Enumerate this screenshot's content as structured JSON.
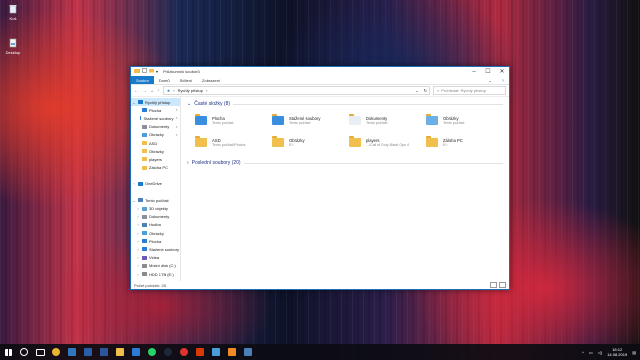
{
  "desktop": {
    "icons": [
      {
        "label": "Koš",
        "icon": "recycle-bin-icon"
      },
      {
        "label": "Desktop",
        "icon": "desktop-file-icon"
      }
    ]
  },
  "window": {
    "title": "Průzkumník souborů",
    "ribbon_tabs": [
      "Soubor",
      "Domů",
      "Sdílení",
      "Zobrazení"
    ],
    "address_path": "Rychlý přístup",
    "search_placeholder": "Prohledat: Rychlý přístup",
    "nav_items": [
      {
        "label": "Rychlý přístup",
        "level": 0,
        "icon": "star-icon",
        "selected": true,
        "expanded": true
      },
      {
        "label": "Plocha",
        "level": 1,
        "icon": "desktop-icon",
        "pinned": true
      },
      {
        "label": "Stažené soubory",
        "level": 1,
        "icon": "download-icon",
        "pinned": true
      },
      {
        "label": "Dokumenty",
        "level": 1,
        "icon": "documents-icon",
        "pinned": true
      },
      {
        "label": "Obrázky",
        "level": 1,
        "icon": "pictures-icon",
        "pinned": true
      },
      {
        "label": "ASD",
        "level": 1,
        "icon": "folder-icon"
      },
      {
        "label": "Obrázky",
        "level": 1,
        "icon": "folder-icon"
      },
      {
        "label": "players",
        "level": 1,
        "icon": "folder-icon"
      },
      {
        "label": "Záloha PC",
        "level": 1,
        "icon": "folder-icon"
      },
      {
        "label": "",
        "level": 0,
        "icon": "spacer"
      },
      {
        "label": "OneDrive",
        "level": 0,
        "icon": "cloud-icon"
      },
      {
        "label": "",
        "level": 0,
        "icon": "spacer"
      },
      {
        "label": "Tento počítač",
        "level": 0,
        "icon": "computer-icon",
        "expanded": true
      },
      {
        "label": "3D objekty",
        "level": 1,
        "icon": "cube-icon"
      },
      {
        "label": "Dokumenty",
        "level": 1,
        "icon": "documents-icon"
      },
      {
        "label": "Hudba",
        "level": 1,
        "icon": "music-icon"
      },
      {
        "label": "Obrázky",
        "level": 1,
        "icon": "pictures-icon"
      },
      {
        "label": "Plocha",
        "level": 1,
        "icon": "desktop-icon"
      },
      {
        "label": "Stažené soubory",
        "level": 1,
        "icon": "download-icon"
      },
      {
        "label": "Videa",
        "level": 1,
        "icon": "video-icon"
      },
      {
        "label": "Místní disk (C:)",
        "level": 1,
        "icon": "drive-icon"
      },
      {
        "label": "HDD 1TB (E:)",
        "level": 1,
        "icon": "drive-icon"
      },
      {
        "label": "",
        "level": 0,
        "icon": "spacer"
      },
      {
        "label": "Síť",
        "level": 0,
        "icon": "network-icon"
      }
    ],
    "groups": [
      {
        "header": "Časté složky (8)",
        "expanded": true
      },
      {
        "header": "Poslední soubory (20)",
        "expanded": false
      }
    ],
    "frequent": [
      {
        "name": "Plocha",
        "sub": "Tento počítač",
        "icon": "desktop-folder-icon"
      },
      {
        "name": "Stažené soubory",
        "sub": "Tento počítač",
        "icon": "download-folder-icon"
      },
      {
        "name": "Dokumenty",
        "sub": "Tento počítač",
        "icon": "documents-folder-icon"
      },
      {
        "name": "Obrázky",
        "sub": "Tento počítač",
        "icon": "pictures-folder-icon"
      },
      {
        "name": "ASD",
        "sub": "Tento počítač\\Plocha",
        "icon": "folder-icon"
      },
      {
        "name": "Obrázky",
        "sub": "E:\\",
        "icon": "folder-icon"
      },
      {
        "name": "players",
        "sub": "...\\Call of Duty Black Ops 4",
        "icon": "folder-icon"
      },
      {
        "name": "Záloha PC",
        "sub": "E:\\",
        "icon": "folder-icon"
      }
    ],
    "status": "Počet položek: 28"
  },
  "taskbar": {
    "apps": [
      "windows-start-icon",
      "search-icon",
      "task-view-icon",
      "chrome-icon",
      "edge-icon",
      "store-icon",
      "word-icon",
      "file-explorer-icon",
      "vscode-icon",
      "whatsapp-icon",
      "steam-icon",
      "opera-icon",
      "office-icon",
      "photos-icon",
      "vlc-icon",
      "app-icon"
    ],
    "time": "18:12",
    "date": "14.08.2019"
  }
}
